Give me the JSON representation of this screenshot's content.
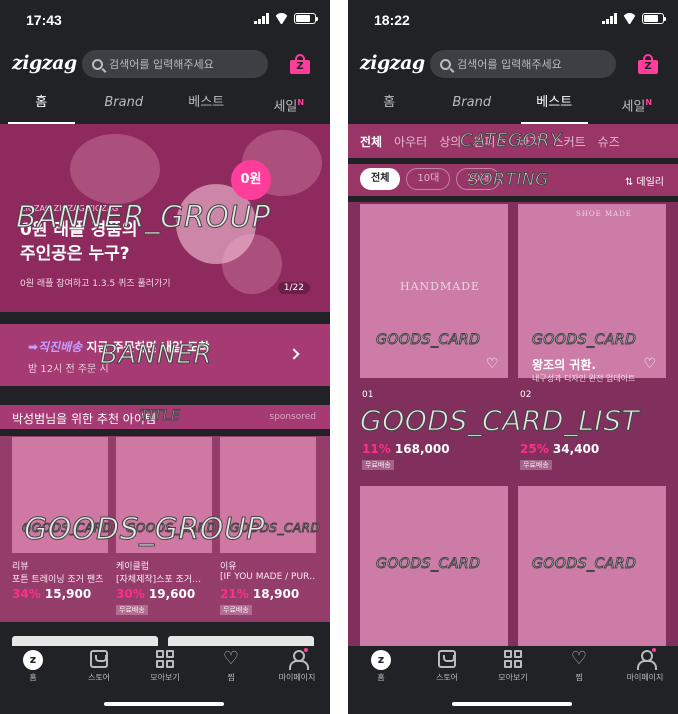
{
  "left": {
    "status_time": "17:43",
    "logo": "zigzag",
    "search_placeholder": "검색어를 입력해주세요",
    "cart_badge": "Z",
    "tabs": [
      {
        "label": "홈",
        "active": true
      },
      {
        "label": "Brand",
        "active": false
      },
      {
        "label": "베스트",
        "active": false
      },
      {
        "label": "세일",
        "badge": "N",
        "active": false
      }
    ],
    "banner_group": {
      "overlay_label": "BANNER_GROUP",
      "badge": "0원",
      "small_text": "ZIGZAG ZIGZAG ZIGZAG",
      "headline_1": "0원 래플 경품의",
      "headline_2": "주인공은 누구?",
      "subtext": "0원 래플 참여하고 1.3.5 퀴즈 풀러가기",
      "page_indicator": "1/22"
    },
    "banner": {
      "overlay_label": "BANNER",
      "keyword": "➡직진배송",
      "line1_rest": " 지금 주문하면 내일 도착",
      "line2": "밤 12시 전 주문 시"
    },
    "title": {
      "text": "박성범님을 위한 추천 아이템",
      "overlay_label": "TITLE",
      "sponsored": "sponsored"
    },
    "goods_group": {
      "overlay_label": "GOODS_GROUP",
      "cards": [
        {
          "overlay_label": "GOODS_CARD",
          "shop": "리뷰",
          "name": "포튼 트레이닝 조거 팬츠",
          "discount": "34%",
          "price": "15,900",
          "tag": ""
        },
        {
          "overlay_label": "GOODS_CARD",
          "shop": "케이클럽",
          "name": "[자체제작]스포 조거…",
          "discount": "30%",
          "price": "19,600",
          "tag": "무료배송"
        },
        {
          "overlay_label": "GOODS_CARD",
          "shop": "이유",
          "name": "[IF YOU MADE / PUR…",
          "discount": "21%",
          "price": "18,900",
          "tag": "무료배송"
        }
      ]
    }
  },
  "right": {
    "status_time": "18:22",
    "logo": "zigzag",
    "search_placeholder": "검색어를 입력해주세요",
    "cart_badge": "Z",
    "tabs": [
      {
        "label": "홈",
        "active": false
      },
      {
        "label": "Brand",
        "active": false
      },
      {
        "label": "베스트",
        "active": true
      },
      {
        "label": "세일",
        "badge": "N",
        "active": false
      }
    ],
    "category": {
      "overlay_label": "CATEGORY",
      "items": [
        "전체",
        "아우터",
        "상의",
        "원피스",
        "바지",
        "스커트",
        "슈즈"
      ]
    },
    "sorting": {
      "overlay_label": "SORTING",
      "chips": [
        "전체",
        "10대",
        "20대"
      ],
      "sort_label": "⇅ 데일리"
    },
    "goods_card_list": {
      "overlay_label": "GOODS_CARD_LIST",
      "cards": [
        {
          "overlay_label": "GOODS_CARD",
          "rank": "01",
          "img_text": "HANDMADE",
          "discount": "11%",
          "price": "168,000",
          "tag": "무료배송"
        },
        {
          "overlay_label": "GOODS_CARD",
          "rank": "02",
          "title": "왕조의 귀환.",
          "subtitle": "내구성과 디자인 완전 업데이트",
          "img_text": "SHOE MADE",
          "discount": "25%",
          "price": "34,400",
          "tag": "무료배송"
        },
        {
          "overlay_label": "GOODS_CARD"
        },
        {
          "overlay_label": "GOODS_CARD"
        }
      ]
    }
  },
  "bottom_nav": [
    {
      "label": "홈",
      "icon": "zigzag-home-icon"
    },
    {
      "label": "스토어",
      "icon": "store-icon"
    },
    {
      "label": "모아보기",
      "icon": "grid-icon"
    },
    {
      "label": "찜",
      "icon": "heart-icon"
    },
    {
      "label": "마이페이지",
      "icon": "user-icon"
    }
  ],
  "colors": {
    "background": "#202226",
    "accent": "#ff3d9a",
    "overlay": "#e8509b"
  }
}
